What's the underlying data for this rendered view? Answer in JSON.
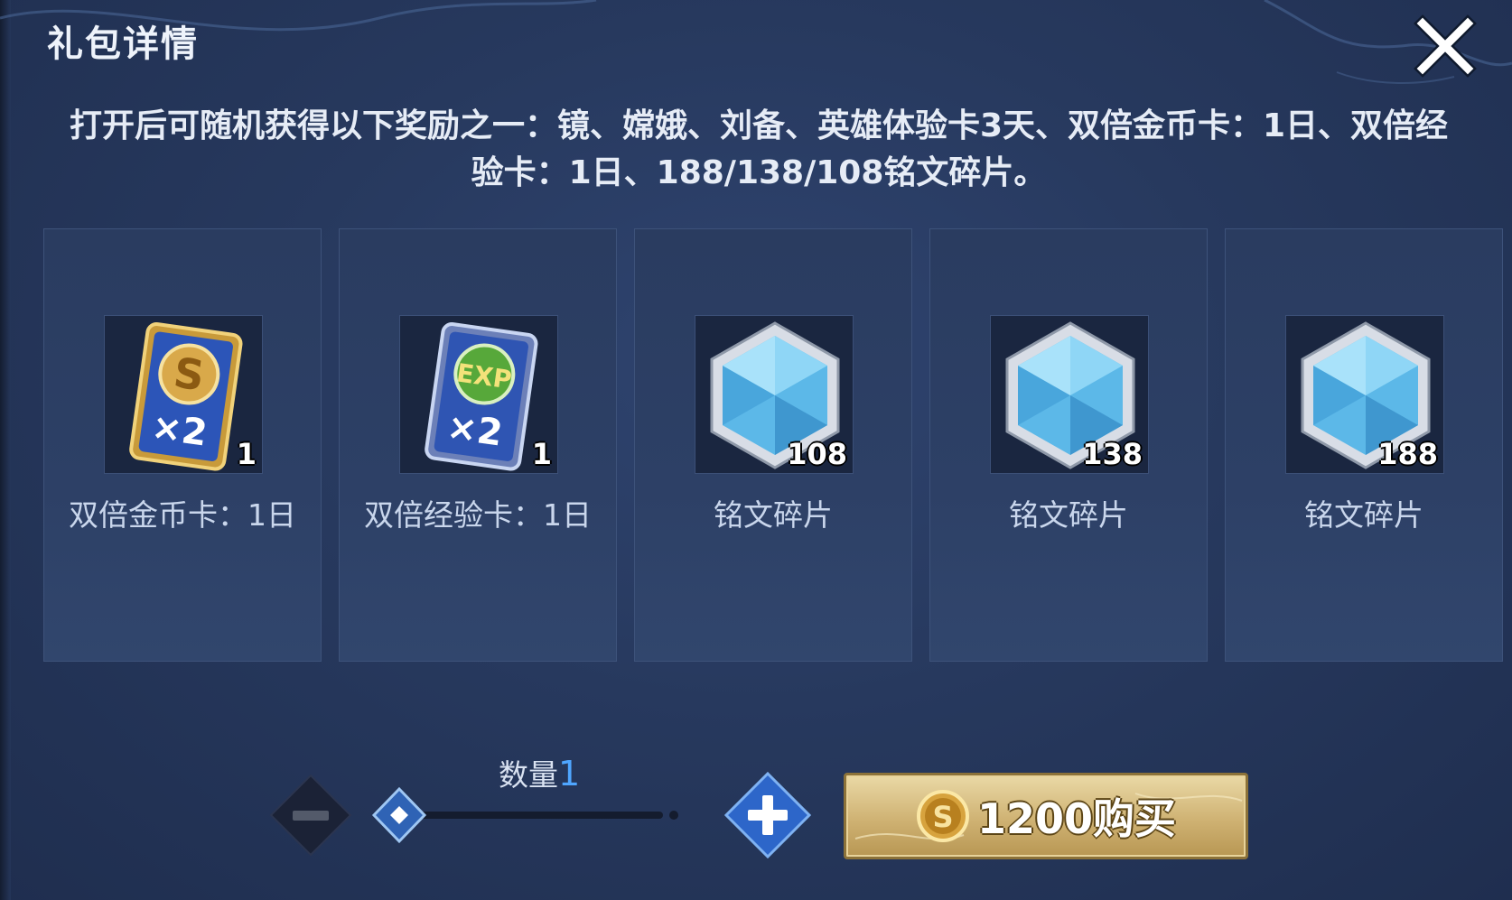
{
  "dialog": {
    "title": "礼包详情",
    "description": "打开后可随机获得以下奖励之一：镜、嫦娥、刘备、英雄体验卡3天、双倍金币卡：1日、双倍经验卡：1日、188/138/108铭文碎片。"
  },
  "rewards": [
    {
      "label": "双倍金币卡：1日",
      "count": "1",
      "icon": "double-gold-card-icon"
    },
    {
      "label": "双倍经验卡：1日",
      "count": "1",
      "icon": "double-exp-card-icon"
    },
    {
      "label": "铭文碎片",
      "count": "108",
      "icon": "inscription-fragment-icon"
    },
    {
      "label": "铭文碎片",
      "count": "138",
      "icon": "inscription-fragment-icon"
    },
    {
      "label": "铭文碎片",
      "count": "188",
      "icon": "inscription-fragment-icon"
    }
  ],
  "quantity": {
    "label": "数量",
    "value": "1"
  },
  "buy": {
    "price": "1200",
    "label": "1200购买",
    "currency_icon": "gold-coin-icon"
  },
  "colors": {
    "panel_bg": "#27395e",
    "accent_blue": "#4fa6ff",
    "buy_gold": "#cfb273"
  }
}
